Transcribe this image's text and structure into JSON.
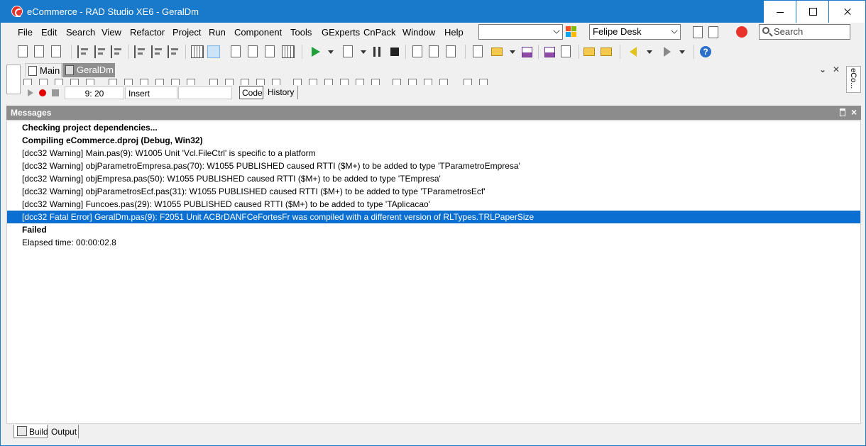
{
  "window": {
    "title": "eCommerce - RAD Studio XE6 - GeralDm"
  },
  "menu": [
    "File",
    "Edit",
    "Search",
    "View",
    "Refactor",
    "Project",
    "Run",
    "Component",
    "Tools",
    "GExperts",
    "CnPack",
    "Window",
    "Help"
  ],
  "combos": {
    "layout_value": "",
    "desktop_value": "Felipe Desk"
  },
  "search": {
    "placeholder": "Search"
  },
  "editor": {
    "tabs": [
      "Main",
      "GeralDm"
    ],
    "cursor_position": "9:  20",
    "mode": "Insert",
    "view_tabs": [
      "Code",
      "History"
    ]
  },
  "right_dock": {
    "label": "eCo..."
  },
  "messages": {
    "title": "Messages",
    "lines": [
      {
        "text": "Checking project dependencies...",
        "style": "bold"
      },
      {
        "text": "Compiling eCommerce.dproj (Debug, Win32)",
        "style": "bold"
      },
      {
        "text": "[dcc32 Warning] Main.pas(9): W1005 Unit 'Vcl.FileCtrl' is specific to a platform",
        "style": "normal"
      },
      {
        "text": "[dcc32 Warning] objParametroEmpresa.pas(70): W1055 PUBLISHED caused RTTI ($M+) to be added to type 'TParametroEmpresa'",
        "style": "normal"
      },
      {
        "text": "[dcc32 Warning] objEmpresa.pas(50): W1055 PUBLISHED caused RTTI ($M+) to be added to type 'TEmpresa'",
        "style": "normal"
      },
      {
        "text": "[dcc32 Warning] objParametrosEcf.pas(31): W1055 PUBLISHED caused RTTI ($M+) to be added to type 'TParametrosEcf'",
        "style": "normal"
      },
      {
        "text": "[dcc32 Warning] Funcoes.pas(29): W1055 PUBLISHED caused RTTI ($M+) to be added to type 'TAplicacao'",
        "style": "normal"
      },
      {
        "text": "[dcc32 Fatal Error] GeralDm.pas(9): F2051 Unit ACBrDANFCeFortesFr was compiled with a different version of RLTypes.TRLPaperSize",
        "style": "selected"
      },
      {
        "text": "Failed",
        "style": "bold"
      },
      {
        "text": "Elapsed time: 00:00:02.8",
        "style": "normal"
      }
    ]
  },
  "bottom_tabs": [
    "Build",
    "Output"
  ],
  "colors": {
    "accent": "#1979ca",
    "selection": "#0a6fd0",
    "pane_header": "#8c8c8c"
  }
}
